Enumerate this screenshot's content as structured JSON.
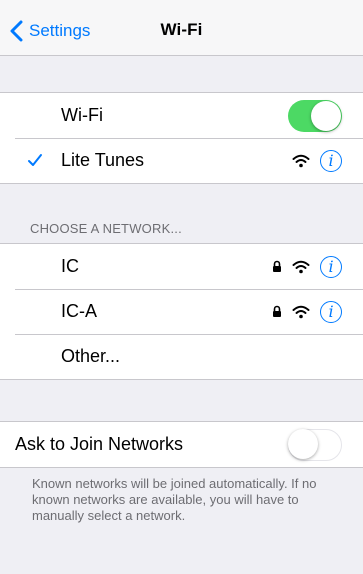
{
  "navbar": {
    "back_label": "Settings",
    "title": "Wi-Fi"
  },
  "wifi_group": {
    "wifi_label": "Wi-Fi",
    "wifi_enabled": true,
    "connected_network": "Lite Tunes"
  },
  "networks": {
    "header": "CHOOSE A NETWORK...",
    "items": [
      {
        "name": "IC",
        "secured": true
      },
      {
        "name": "IC-A",
        "secured": true
      }
    ],
    "other_label": "Other..."
  },
  "ask_join": {
    "label": "Ask to Join Networks",
    "enabled": false,
    "description": "Known networks will be joined automatically. If no known networks are available, you will have to manually select a network."
  },
  "colors": {
    "accent": "#007aff",
    "toggle_on": "#4cd964",
    "background": "#efeff4"
  }
}
